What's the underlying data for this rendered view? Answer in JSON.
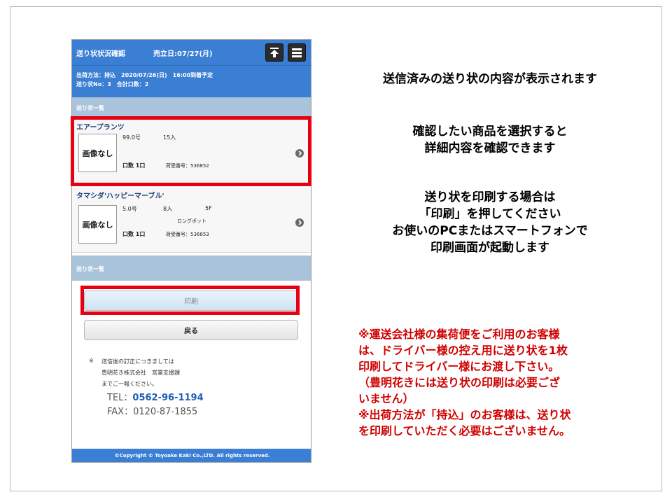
{
  "phone": {
    "header": {
      "title": "送り状状況確認",
      "sales_date": "売立日:07/27(月)"
    },
    "shipment": {
      "line1": "出荷方法：持込　2020/07/26(日)　16:00到着予定",
      "line2": "送り状No：3　合計口数：2"
    },
    "section1": "送り状一覧",
    "items": [
      {
        "name": "エアープランツ",
        "image_label": "画像なし",
        "grade": "99.0号",
        "quantity": "15入",
        "spec": "",
        "note": "",
        "units": "口数 1口",
        "receipt": "荷受番号：536852"
      },
      {
        "name": "タマシダ'ハッピーマーブル'",
        "image_label": "画像なし",
        "grade": "5.0号",
        "quantity": "8入",
        "spec": "5F",
        "note": "ロングポット",
        "units": "口数 1口",
        "receipt": "荷受番号：536853"
      }
    ],
    "section2": "送り状一覧",
    "buttons": {
      "print": "印刷",
      "back": "戻る"
    },
    "contact": {
      "mark": "※",
      "line1": "送信後の訂正につきましては",
      "line2": "豊明花き株式会社　営業支援課",
      "line3": "までご一報ください。",
      "tel_label": "TEL：",
      "tel": "0562-96-1194",
      "fax": "FAX：0120-87-1855"
    },
    "footer": "©Copyright © Toyoake Kaki Co.,LTD. All rights reserved.",
    "colors": {
      "header": "#3a7fd4",
      "section": "#a9c3db",
      "highlight": "#e60012"
    }
  },
  "instructions": {
    "block1": [
      "送信済みの送り状の内容が表示されます"
    ],
    "block2": [
      "確認したい商品を選択すると",
      "詳細内容を確認できます"
    ],
    "block3": [
      "送り状を印刷する場合は",
      "「印刷」を押してください",
      "お使いのPCまたはスマートフォンで",
      "印刷画面が起動します"
    ],
    "warning": [
      "※運送会社様の集荷便をご利用のお客様",
      "は、ドライバー様の控え用に送り状を1枚",
      "印刷してドライバー様にお渡し下さい。",
      "（豊明花きには送り状の印刷は必要ござ",
      "いません）",
      "※出荷方法が「持込」のお客様は、送り状",
      "を印刷していただく必要はございません。"
    ]
  }
}
